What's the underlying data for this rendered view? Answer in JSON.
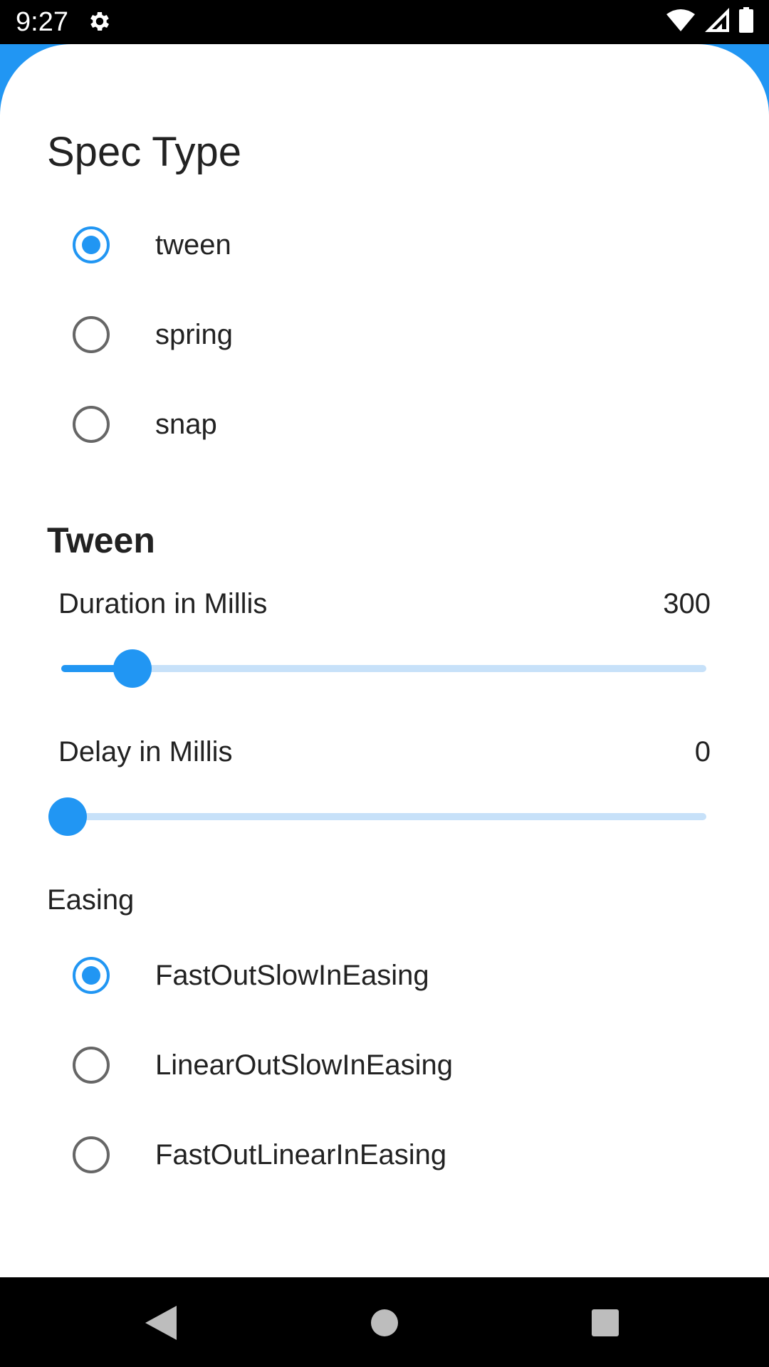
{
  "status_bar": {
    "time": "9:27"
  },
  "spec_type": {
    "title": "Spec Type",
    "options": [
      {
        "label": "tween",
        "selected": true
      },
      {
        "label": "spring",
        "selected": false
      },
      {
        "label": "snap",
        "selected": false
      }
    ]
  },
  "tween": {
    "title": "Tween",
    "duration": {
      "label": "Duration in Millis",
      "value": "300",
      "fraction": 0.11
    },
    "delay": {
      "label": "Delay in Millis",
      "value": "0",
      "fraction": 0.0
    }
  },
  "easing": {
    "title": "Easing",
    "options": [
      {
        "label": "FastOutSlowInEasing",
        "selected": true
      },
      {
        "label": "LinearOutSlowInEasing",
        "selected": false
      },
      {
        "label": "FastOutLinearInEasing",
        "selected": false
      }
    ]
  },
  "colors": {
    "accent": "#2196F3",
    "track_inactive": "#C7E1F9"
  },
  "icons": {
    "status_left": "gear-icon",
    "status_right": [
      "wifi-icon",
      "signal-icon",
      "battery-icon"
    ],
    "nav": [
      "back-icon",
      "home-icon",
      "recents-icon"
    ]
  }
}
